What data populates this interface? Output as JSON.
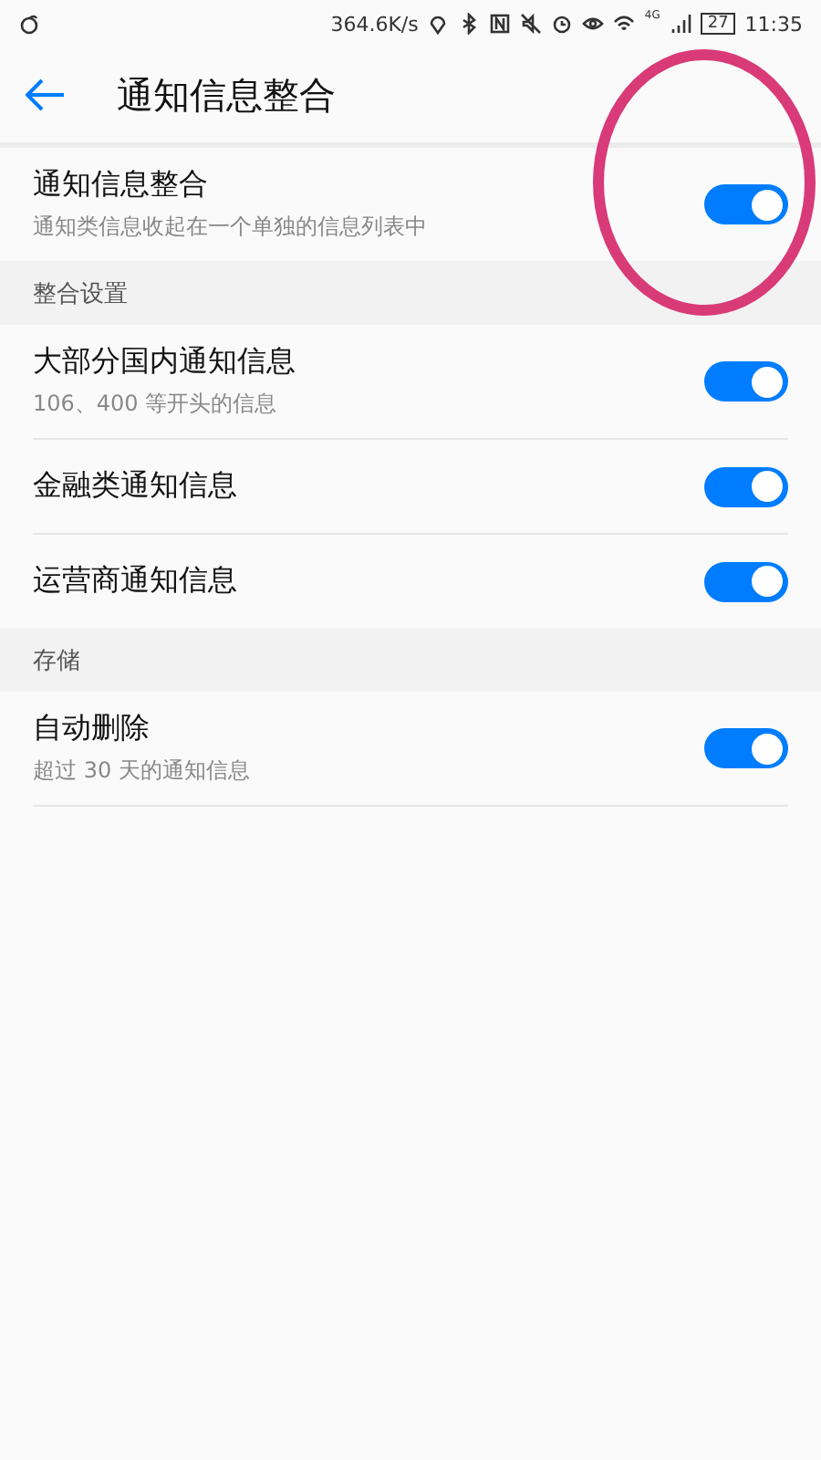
{
  "status_bar": {
    "speed": "364.6K/s",
    "network": "4G",
    "battery": "27",
    "time": "11:35"
  },
  "header": {
    "title": "通知信息整合"
  },
  "sections": [
    {
      "rows": [
        {
          "label": "通知信息整合",
          "sublabel": "通知类信息收起在一个单独的信息列表中",
          "on": true
        }
      ]
    },
    {
      "title": "整合设置",
      "rows": [
        {
          "label": "大部分国内通知信息",
          "sublabel": "106、400 等开头的信息",
          "on": true
        },
        {
          "label": "金融类通知信息",
          "on": true
        },
        {
          "label": "运营商通知信息",
          "on": true
        }
      ]
    },
    {
      "title": "存储",
      "rows": [
        {
          "label": "自动删除",
          "sublabel": "超过 30 天的通知信息",
          "on": true
        }
      ]
    }
  ],
  "annotation": {
    "kind": "ellipse",
    "color": "#d93a78"
  }
}
